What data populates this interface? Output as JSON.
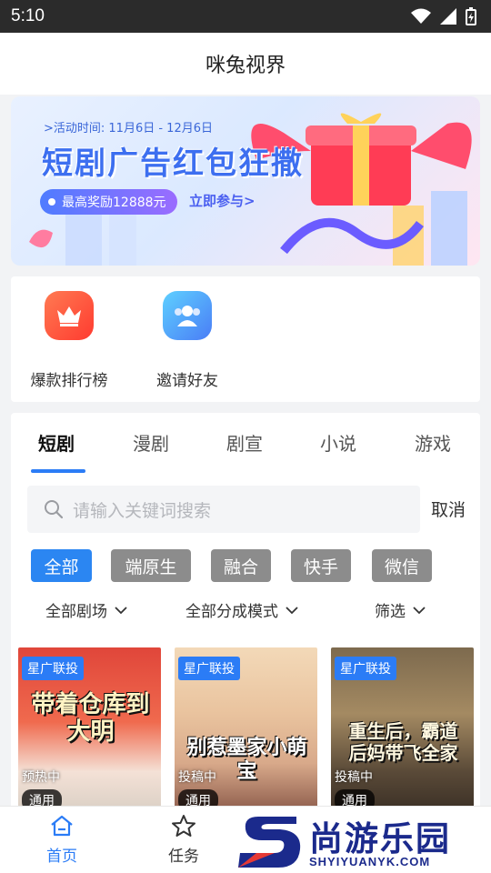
{
  "status_bar": {
    "time": "5:10"
  },
  "header": {
    "title": "咪兔视界"
  },
  "banner": {
    "period": ">活动时间: 11月6日 - 12月6日",
    "headline": "短剧广告红包狂撒",
    "reward": "最高奖励12888元",
    "join": "立即参与>"
  },
  "quick_actions": [
    {
      "label": "爆款排行榜",
      "icon": "crown-icon",
      "color": "#ff4d3a"
    },
    {
      "label": "邀请好友",
      "icon": "users-icon",
      "color": "#4a8df6"
    }
  ],
  "tabs": [
    {
      "label": "短剧",
      "active": true
    },
    {
      "label": "漫剧"
    },
    {
      "label": "剧宣"
    },
    {
      "label": "小说"
    },
    {
      "label": "游戏"
    }
  ],
  "search": {
    "placeholder": "请输入关键词搜索",
    "cancel": "取消"
  },
  "chips": [
    {
      "label": "全部",
      "active": true
    },
    {
      "label": "端原生"
    },
    {
      "label": "融合"
    },
    {
      "label": "快手"
    },
    {
      "label": "微信"
    }
  ],
  "filters": [
    {
      "label": "全部剧场"
    },
    {
      "label": "全部分成模式"
    },
    {
      "label": "筛选"
    }
  ],
  "cards": [
    {
      "tag": "星广联投",
      "poster_title": "带着仓库到大明",
      "status": "预热中",
      "badge": "通用"
    },
    {
      "tag": "星广联投",
      "poster_title": "别惹墨家小萌宝",
      "status": "投稿中",
      "badge": "通用"
    },
    {
      "tag": "星广联投",
      "poster_title": "重生后，霸道后妈带飞全家",
      "status": "投稿中",
      "badge": "通用"
    }
  ],
  "bottom_nav": [
    {
      "label": "首页",
      "icon": "home-icon",
      "active": true
    },
    {
      "label": "任务",
      "icon": "star-icon"
    }
  ],
  "watermark": {
    "text": "尚游乐园",
    "url": "SHYIYUANYK.COM"
  },
  "colors": {
    "accent": "#2b7cf6",
    "chip_inactive": "#8c8c8c"
  }
}
